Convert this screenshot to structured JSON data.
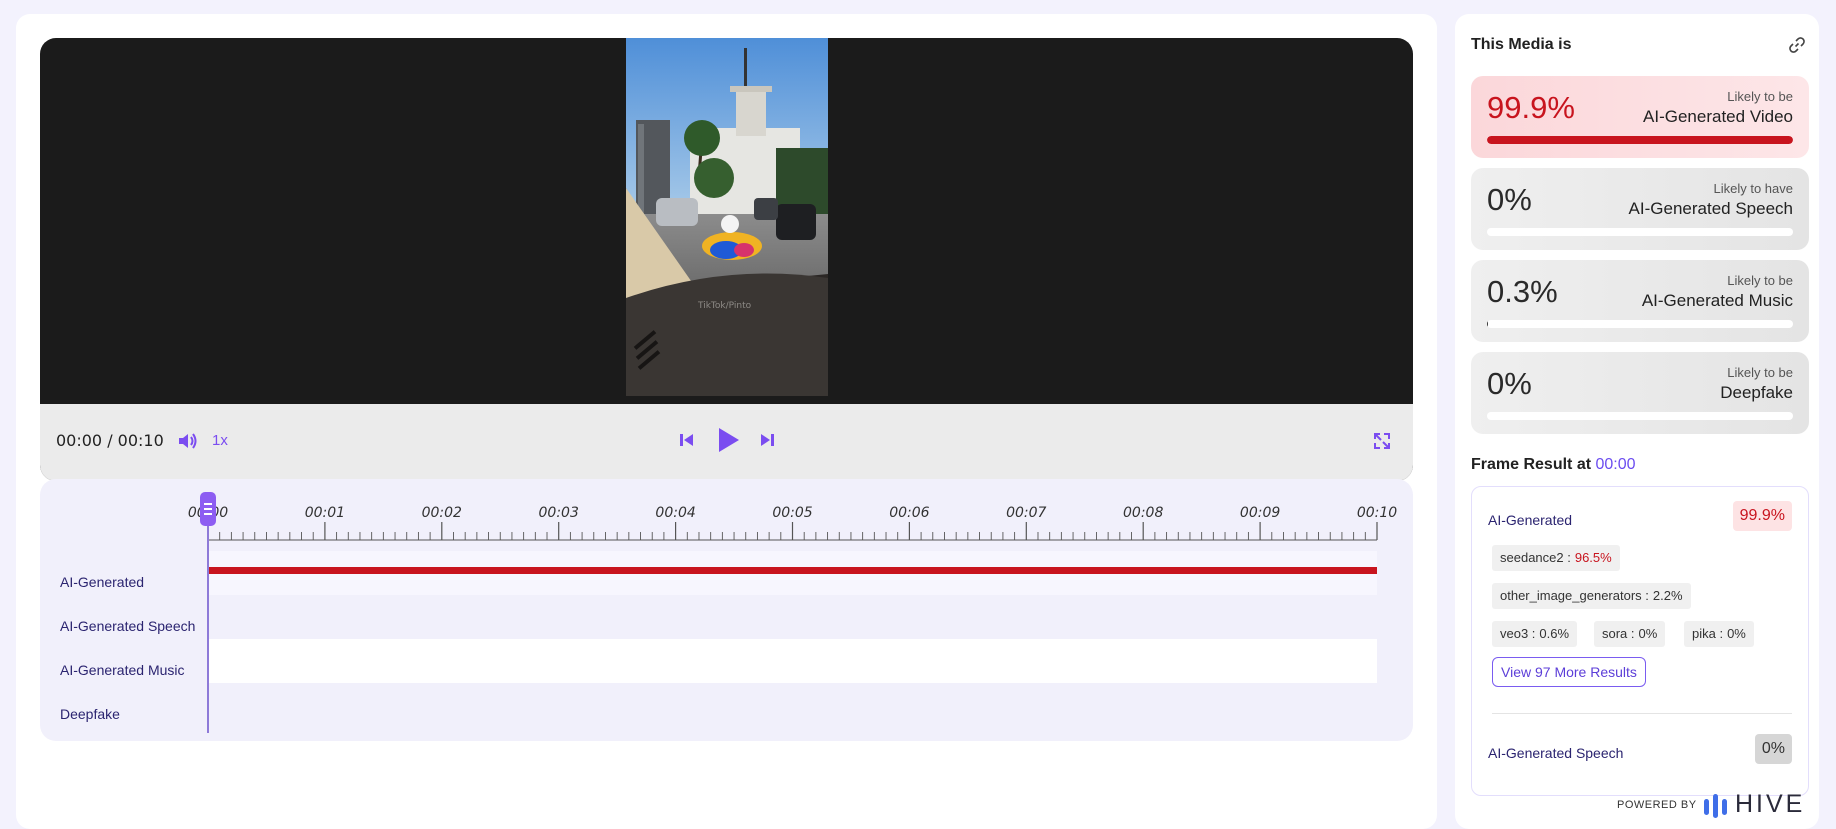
{
  "player": {
    "time": "00:00 / 00:10",
    "speed": "1x",
    "watermark": "TikTok/Pinto"
  },
  "timeline": {
    "ticks": [
      "00:00",
      "00:01",
      "00:02",
      "00:03",
      "00:04",
      "00:05",
      "00:06",
      "00:07",
      "00:08",
      "00:09",
      "00:10"
    ],
    "tracks": [
      {
        "label": "AI-Generated",
        "detected_fraction": 1.0
      },
      {
        "label": "AI-Generated Speech",
        "detected_fraction": 0.0
      },
      {
        "label": "AI-Generated Music",
        "detected_fraction": 0.0
      },
      {
        "label": "Deepfake",
        "detected_fraction": 0.0
      }
    ]
  },
  "results": {
    "title": "This Media is",
    "cards": [
      {
        "percent": "99.9%",
        "sub": "Likely to be",
        "main": "AI-Generated Video",
        "fill": 0.999,
        "highlight": true
      },
      {
        "percent": "0%",
        "sub": "Likely to have",
        "main": "AI-Generated Speech",
        "fill": 0.0,
        "highlight": false
      },
      {
        "percent": "0.3%",
        "sub": "Likely to be",
        "main": "AI-Generated Music",
        "fill": 0.003,
        "highlight": false
      },
      {
        "percent": "0%",
        "sub": "Likely to be",
        "main": "Deepfake",
        "fill": 0.0,
        "highlight": false
      }
    ]
  },
  "frame": {
    "title": "Frame Result at",
    "timestamp": "00:00",
    "ai_label": "AI-Generated",
    "ai_value": "99.9%",
    "models": [
      {
        "name": "seedance2 :",
        "value": "96.5%"
      },
      {
        "name": "other_image_generators :",
        "value": "2.2%"
      },
      {
        "name": "veo3 :",
        "value": "0.6%"
      },
      {
        "name": "sora :",
        "value": "0%"
      },
      {
        "name": "pika :",
        "value": "0%"
      }
    ],
    "more_button": "View 97 More Results",
    "speech_label": "AI-Generated Speech",
    "speech_value": "0%"
  },
  "footer": {
    "powered_by": "POWERED BY",
    "brand": "HIVE"
  },
  "colors": {
    "accent": "#7b4df0",
    "danger": "#c8141e",
    "panel_bg": "#f3f2fd"
  }
}
